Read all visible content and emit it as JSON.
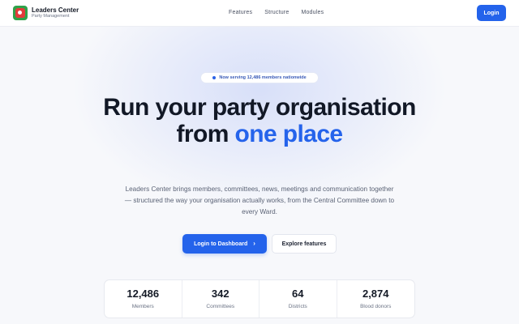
{
  "brand": {
    "name": "Leaders Center",
    "subtitle": "Party Management"
  },
  "nav": {
    "items": [
      {
        "label": "Features"
      },
      {
        "label": "Structure"
      },
      {
        "label": "Modules"
      }
    ],
    "login_label": "Login"
  },
  "hero": {
    "badge": "Now serving 12,486 members nationwide",
    "headline_main": "Run your party organisation from ",
    "headline_accent": "one place",
    "lead": "Leaders Center brings members, committees, news, meetings and communication together — structured the way your organisation actually works, from the Central Committee down to every Ward.",
    "primary_cta": "Login to Dashboard",
    "secondary_cta": "Explore features"
  },
  "stats": [
    {
      "value": "12,486",
      "label": "Members"
    },
    {
      "value": "342",
      "label": "Committees"
    },
    {
      "value": "64",
      "label": "Districts"
    },
    {
      "value": "2,874",
      "label": "Blood donors"
    }
  ],
  "colors": {
    "accent": "#2563eb",
    "logo_green": "#2fa24a",
    "logo_red": "#e23b3b"
  },
  "icons": {
    "logo": "party-logo-icon",
    "badge_dot": "status-dot-icon",
    "cta_arrow": "chevron-right-icon"
  }
}
